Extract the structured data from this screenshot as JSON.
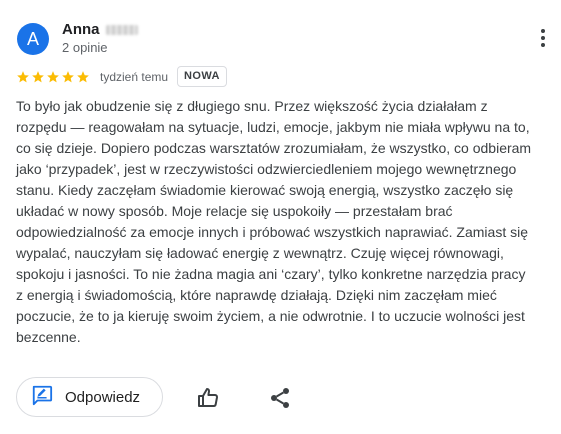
{
  "reviewer": {
    "initial": "A",
    "name": "Anna",
    "review_count": "2 opinie"
  },
  "rating": {
    "stars": 5,
    "max": 5,
    "timestamp": "tydzień temu",
    "badge": "NOWA"
  },
  "review": {
    "text": "To było jak obudzenie się z długiego snu. Przez większość życia działałam z rozpędu — reagowałam na sytuacje, ludzi, emocje, jakbym nie miała wpływu na to, co się dzieje. Dopiero podczas warsztatów zrozumiałam, że wszystko, co odbieram jako ‘przypadek’, jest w rzeczywistości odzwierciedleniem mojego wewnętrznego stanu. Kiedy zaczęłam świadomie kierować swoją energią, wszystko zaczęło się układać w nowy sposób. Moje relacje się uspokoiły — przestałam brać odpowiedzialność za emocje innych i próbować wszystkich naprawiać. Zamiast się wypalać, nauczyłam się ładować energię z wewnątrz. Czuję więcej równowagi, spokoju i jasności. To nie żadna magia ani ‘czary’, tylko konkretne narzędzia pracy z energią i świadomością, które naprawdę działają. Dzięki nim zaczęłam mieć poczucie, że to ja kieruję swoim życiem, a nie odwrotnie. I to uczucie wolności jest bezcenne."
  },
  "actions": {
    "reply_label": "Odpowiedz",
    "reply_icon": "reply-edit-icon",
    "like_icon": "thumbs-up-icon",
    "share_icon": "share-icon",
    "menu_icon": "more-vert-icon"
  },
  "colors": {
    "avatar_bg": "#1a73e8",
    "star": "#fbbc04",
    "reply_icon": "#1a73e8"
  }
}
